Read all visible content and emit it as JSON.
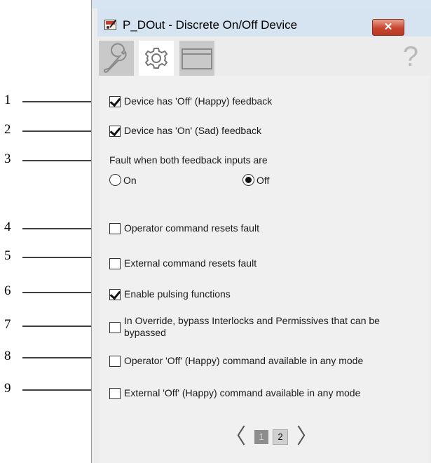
{
  "window": {
    "title": "P_DOut - Discrete On/Off Device",
    "close_label": "✕"
  },
  "tabs": {
    "maintenance_icon": "wrench-icon",
    "configuration_icon": "gear-icon",
    "display_icon": "window-icon",
    "help_label": "?"
  },
  "callouts": [
    "1",
    "2",
    "3",
    "4",
    "5",
    "6",
    "7",
    "8",
    "9"
  ],
  "options": {
    "off_feedback": {
      "label": "Device has 'Off' (Happy) feedback",
      "checked": true
    },
    "on_feedback": {
      "label": "Device has 'On' (Sad) feedback",
      "checked": true
    },
    "fault_title": "Fault when both feedback inputs are",
    "fault_on": {
      "label": "On",
      "selected": false
    },
    "fault_off": {
      "label": "Off",
      "selected": true
    },
    "operator_reset": {
      "label": "Operator command resets fault",
      "checked": false
    },
    "external_reset": {
      "label": "External command resets fault",
      "checked": false
    },
    "pulsing": {
      "label": "Enable pulsing functions",
      "checked": true
    },
    "override_bypass": {
      "label": "In Override, bypass Interlocks and Permissives that can be bypassed",
      "checked": false
    },
    "operator_off_any": {
      "label": "Operator 'Off' (Happy) command available in any mode",
      "checked": false
    },
    "external_off_any": {
      "label": "External 'Off' (Happy) command available in any mode",
      "checked": false
    }
  },
  "pager": {
    "prev": "〈",
    "page1": "1",
    "page2": "2",
    "next": "〉"
  }
}
